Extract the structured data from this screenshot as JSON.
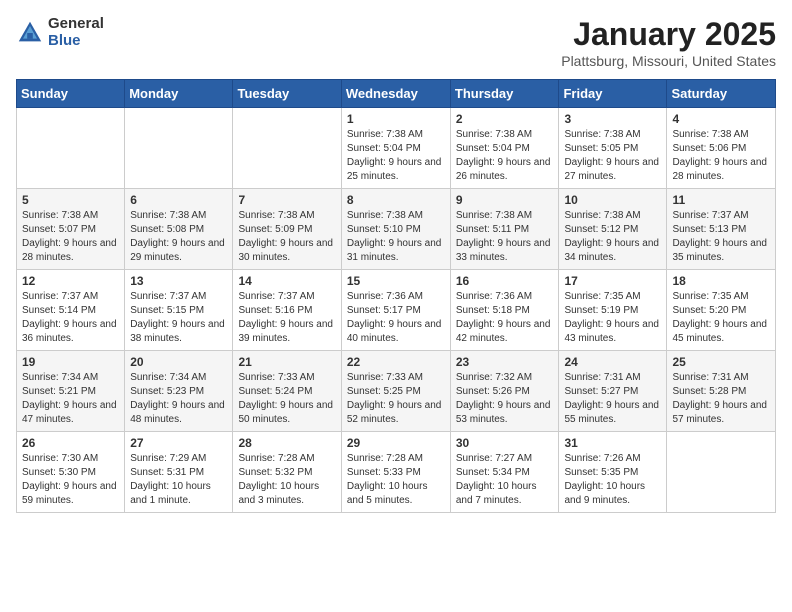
{
  "header": {
    "logo_general": "General",
    "logo_blue": "Blue",
    "title": "January 2025",
    "subtitle": "Plattsburg, Missouri, United States"
  },
  "weekdays": [
    "Sunday",
    "Monday",
    "Tuesday",
    "Wednesday",
    "Thursday",
    "Friday",
    "Saturday"
  ],
  "rows": [
    [
      {
        "day": "",
        "info": ""
      },
      {
        "day": "",
        "info": ""
      },
      {
        "day": "",
        "info": ""
      },
      {
        "day": "1",
        "info": "Sunrise: 7:38 AM\nSunset: 5:04 PM\nDaylight: 9 hours and 25 minutes."
      },
      {
        "day": "2",
        "info": "Sunrise: 7:38 AM\nSunset: 5:04 PM\nDaylight: 9 hours and 26 minutes."
      },
      {
        "day": "3",
        "info": "Sunrise: 7:38 AM\nSunset: 5:05 PM\nDaylight: 9 hours and 27 minutes."
      },
      {
        "day": "4",
        "info": "Sunrise: 7:38 AM\nSunset: 5:06 PM\nDaylight: 9 hours and 28 minutes."
      }
    ],
    [
      {
        "day": "5",
        "info": "Sunrise: 7:38 AM\nSunset: 5:07 PM\nDaylight: 9 hours and 28 minutes."
      },
      {
        "day": "6",
        "info": "Sunrise: 7:38 AM\nSunset: 5:08 PM\nDaylight: 9 hours and 29 minutes."
      },
      {
        "day": "7",
        "info": "Sunrise: 7:38 AM\nSunset: 5:09 PM\nDaylight: 9 hours and 30 minutes."
      },
      {
        "day": "8",
        "info": "Sunrise: 7:38 AM\nSunset: 5:10 PM\nDaylight: 9 hours and 31 minutes."
      },
      {
        "day": "9",
        "info": "Sunrise: 7:38 AM\nSunset: 5:11 PM\nDaylight: 9 hours and 33 minutes."
      },
      {
        "day": "10",
        "info": "Sunrise: 7:38 AM\nSunset: 5:12 PM\nDaylight: 9 hours and 34 minutes."
      },
      {
        "day": "11",
        "info": "Sunrise: 7:37 AM\nSunset: 5:13 PM\nDaylight: 9 hours and 35 minutes."
      }
    ],
    [
      {
        "day": "12",
        "info": "Sunrise: 7:37 AM\nSunset: 5:14 PM\nDaylight: 9 hours and 36 minutes."
      },
      {
        "day": "13",
        "info": "Sunrise: 7:37 AM\nSunset: 5:15 PM\nDaylight: 9 hours and 38 minutes."
      },
      {
        "day": "14",
        "info": "Sunrise: 7:37 AM\nSunset: 5:16 PM\nDaylight: 9 hours and 39 minutes."
      },
      {
        "day": "15",
        "info": "Sunrise: 7:36 AM\nSunset: 5:17 PM\nDaylight: 9 hours and 40 minutes."
      },
      {
        "day": "16",
        "info": "Sunrise: 7:36 AM\nSunset: 5:18 PM\nDaylight: 9 hours and 42 minutes."
      },
      {
        "day": "17",
        "info": "Sunrise: 7:35 AM\nSunset: 5:19 PM\nDaylight: 9 hours and 43 minutes."
      },
      {
        "day": "18",
        "info": "Sunrise: 7:35 AM\nSunset: 5:20 PM\nDaylight: 9 hours and 45 minutes."
      }
    ],
    [
      {
        "day": "19",
        "info": "Sunrise: 7:34 AM\nSunset: 5:21 PM\nDaylight: 9 hours and 47 minutes."
      },
      {
        "day": "20",
        "info": "Sunrise: 7:34 AM\nSunset: 5:23 PM\nDaylight: 9 hours and 48 minutes."
      },
      {
        "day": "21",
        "info": "Sunrise: 7:33 AM\nSunset: 5:24 PM\nDaylight: 9 hours and 50 minutes."
      },
      {
        "day": "22",
        "info": "Sunrise: 7:33 AM\nSunset: 5:25 PM\nDaylight: 9 hours and 52 minutes."
      },
      {
        "day": "23",
        "info": "Sunrise: 7:32 AM\nSunset: 5:26 PM\nDaylight: 9 hours and 53 minutes."
      },
      {
        "day": "24",
        "info": "Sunrise: 7:31 AM\nSunset: 5:27 PM\nDaylight: 9 hours and 55 minutes."
      },
      {
        "day": "25",
        "info": "Sunrise: 7:31 AM\nSunset: 5:28 PM\nDaylight: 9 hours and 57 minutes."
      }
    ],
    [
      {
        "day": "26",
        "info": "Sunrise: 7:30 AM\nSunset: 5:30 PM\nDaylight: 9 hours and 59 minutes."
      },
      {
        "day": "27",
        "info": "Sunrise: 7:29 AM\nSunset: 5:31 PM\nDaylight: 10 hours and 1 minute."
      },
      {
        "day": "28",
        "info": "Sunrise: 7:28 AM\nSunset: 5:32 PM\nDaylight: 10 hours and 3 minutes."
      },
      {
        "day": "29",
        "info": "Sunrise: 7:28 AM\nSunset: 5:33 PM\nDaylight: 10 hours and 5 minutes."
      },
      {
        "day": "30",
        "info": "Sunrise: 7:27 AM\nSunset: 5:34 PM\nDaylight: 10 hours and 7 minutes."
      },
      {
        "day": "31",
        "info": "Sunrise: 7:26 AM\nSunset: 5:35 PM\nDaylight: 10 hours and 9 minutes."
      },
      {
        "day": "",
        "info": ""
      }
    ]
  ]
}
